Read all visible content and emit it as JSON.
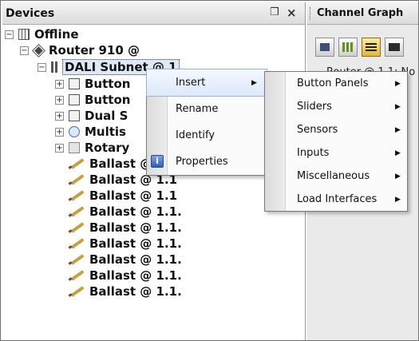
{
  "devices_panel": {
    "title": "Devices",
    "pin_glyph": "❒",
    "close_glyph": "×"
  },
  "tree": {
    "root": "Offline",
    "router": "Router 910 @",
    "bus": "DALI Subnet @ 1",
    "children": [
      "Button",
      "Button",
      "Dual S",
      "Multis",
      "Rotary",
      "Ballast @ 1.1"
    ],
    "ballasts": [
      "Ballast @ 1.1",
      "Ballast @ 1.1",
      "Ballast @ 1.1.",
      "Ballast @ 1.1.",
      "Ballast @ 1.1.",
      "Ballast @ 1.1.",
      "Ballast @ 1.1.",
      "Ballast @ 1.1."
    ]
  },
  "channel_panel": {
    "title": "Channel Graph",
    "node_label": "Router @ 1.1: No"
  },
  "context_menu": {
    "items": [
      "Insert",
      "Rename",
      "Identify",
      "Properties"
    ],
    "properties_icon": "properties-icon"
  },
  "submenu": {
    "items": [
      "Button Panels",
      "Sliders",
      "Sensors",
      "Inputs",
      "Miscellaneous",
      "Load Interfaces"
    ]
  },
  "colors": {
    "accent": "#2f5fb1",
    "menu_bg": "#fbfbfb",
    "selection": "#dfe8f6"
  }
}
